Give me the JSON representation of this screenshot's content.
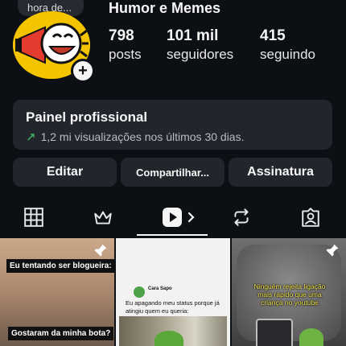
{
  "note": {
    "text": "hora de..."
  },
  "profile": {
    "name": "Humor e Memes",
    "stats": [
      {
        "value": "798",
        "label": "posts"
      },
      {
        "value": "101 mil",
        "label": "seguidores"
      },
      {
        "value": "415",
        "label": "seguindo"
      }
    ]
  },
  "dashboard": {
    "title": "Painel profissional",
    "subtitle": "1,2 mi visualizações nos últimos 30 dias.",
    "accent": "#3ec46d"
  },
  "actions": {
    "edit": "Editar",
    "share": "Compartilhar...",
    "subscription": "Assinatura"
  },
  "tabs": {
    "items": [
      "grid-icon",
      "crown-icon",
      "reels-icon",
      "repost-icon",
      "tagged-icon"
    ],
    "active": "reels-icon",
    "chevron": "›"
  },
  "posts": [
    {
      "caption_top": "Eu tentando ser blogueira:",
      "caption_bottom": "Gostaram da minha bota?",
      "pinned": true
    },
    {
      "tweet_name": "Cara Sapo",
      "tweet_text": "Eu apagando meu status porque já atingiu quem eu queria:",
      "pinned": false
    },
    {
      "caption": "Ninguém rejeita ligação mais rápido que uma criança no youtube",
      "caption_color": "#f2e34a",
      "pinned": true
    }
  ]
}
